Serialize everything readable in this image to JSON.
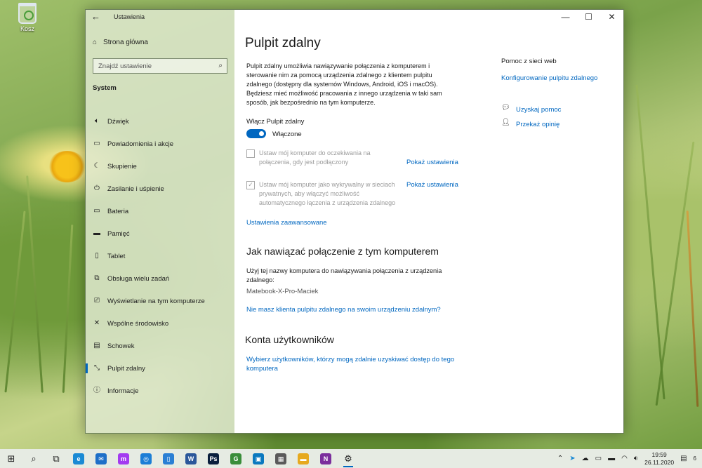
{
  "desktop": {
    "recycle_bin_label": "Kosz"
  },
  "window": {
    "title": "Ustawienia",
    "controls": {
      "minimize": "—",
      "maximize": "☐",
      "close": "✕"
    }
  },
  "sidebar": {
    "home_label": "Strona główna",
    "search_placeholder": "Znajdź ustawienie",
    "section": "System",
    "items": [
      {
        "label": "Dźwięk",
        "icon": "speaker-icon",
        "glyph": "🔈︎"
      },
      {
        "label": "Powiadomienia i akcje",
        "icon": "notifications-icon",
        "glyph": "▭"
      },
      {
        "label": "Skupienie",
        "icon": "moon-icon",
        "glyph": "☾"
      },
      {
        "label": "Zasilanie i uśpienie",
        "icon": "power-icon",
        "glyph": "⏻"
      },
      {
        "label": "Bateria",
        "icon": "battery-icon",
        "glyph": "▭"
      },
      {
        "label": "Pamięć",
        "icon": "storage-icon",
        "glyph": "▬"
      },
      {
        "label": "Tablet",
        "icon": "tablet-icon",
        "glyph": "▯"
      },
      {
        "label": "Obsługa wielu zadań",
        "icon": "multitasking-icon",
        "glyph": "⧉"
      },
      {
        "label": "Wyświetlanie na tym komputerze",
        "icon": "projecting-icon",
        "glyph": "⎚"
      },
      {
        "label": "Wspólne środowisko",
        "icon": "shared-experiences-icon",
        "glyph": "✕"
      },
      {
        "label": "Schowek",
        "icon": "clipboard-icon",
        "glyph": "▤"
      },
      {
        "label": "Pulpit zdalny",
        "icon": "remote-desktop-icon",
        "glyph": "⤡",
        "active": true
      },
      {
        "label": "Informacje",
        "icon": "info-icon",
        "glyph": "ⓘ"
      }
    ]
  },
  "main": {
    "title": "Pulpit zdalny",
    "description": "Pulpit zdalny umożliwia nawiązywanie połączenia z komputerem i sterowanie nim za pomocą urządzenia zdalnego z klientem pulpitu zdalnego (dostępny dla systemów Windows, Android, iOS i macOS). Będziesz mieć możliwość pracowania z innego urządzenia w taki sam sposób, jak bezpośrednio na tym komputerze.",
    "toggle_label": "Włącz Pulpit zdalny",
    "toggle_state": "Włączone",
    "toggle_on": true,
    "option1": {
      "label": "Ustaw mój komputer do oczekiwania na połączenia, gdy jest podłączony",
      "checked": false,
      "link": "Pokaż ustawienia"
    },
    "option2": {
      "label": "Ustaw mój komputer jako wykrywalny w sieciach prywatnych, aby włączyć możliwość automatycznego łączenia z urządzenia zdalnego",
      "checked": true,
      "link": "Pokaż ustawienia"
    },
    "advanced_link": "Ustawienia zaawansowane",
    "connect_heading": "Jak nawiązać połączenie z tym komputerem",
    "connect_text": "Użyj tej nazwy komputera do nawiązywania połączenia z urządzenia zdalnego:",
    "computer_name": "Matebook-X-Pro-Maciek",
    "no_client_link": "Nie masz klienta pulpitu zdalnego na swoim urządzeniu zdalnym?",
    "accounts_heading": "Konta użytkowników",
    "accounts_link": "Wybierz użytkowników, którzy mogą zdalnie uzyskiwać dostęp do tego komputera"
  },
  "help": {
    "heading": "Pomoc z sieci web",
    "web_link": "Konfigurowanie pulpitu zdalnego",
    "get_help": "Uzyskaj pomoc",
    "feedback": "Przekaż opinię"
  },
  "taskbar": {
    "apps": [
      {
        "name": "start-button",
        "glyph": "⊞",
        "color": ""
      },
      {
        "name": "search-button",
        "glyph": "⌕",
        "color": ""
      },
      {
        "name": "task-view-button",
        "glyph": "⧉",
        "color": ""
      },
      {
        "name": "edge-app",
        "glyph": "e",
        "color": "#1a8ad4"
      },
      {
        "name": "mail-app",
        "glyph": "✉",
        "color": "#1e6fc8"
      },
      {
        "name": "messenger-app",
        "glyph": "m",
        "color": "#a33bf0"
      },
      {
        "name": "maps-app",
        "glyph": "◎",
        "color": "#1c7ed6"
      },
      {
        "name": "phone-app",
        "glyph": "▯",
        "color": "#2a7fd4"
      },
      {
        "name": "word-app",
        "glyph": "W",
        "color": "#2b579a"
      },
      {
        "name": "photoshop-app",
        "glyph": "Ps",
        "color": "#0a1f3d"
      },
      {
        "name": "chrome-app",
        "glyph": "G",
        "color": "#3a8d3a"
      },
      {
        "name": "trello-app",
        "glyph": "▣",
        "color": "#0a79bf"
      },
      {
        "name": "calculator-app",
        "glyph": "▦",
        "color": "#5a5a5a"
      },
      {
        "name": "explorer-app",
        "glyph": "▬",
        "color": "#e6a91f"
      },
      {
        "name": "onenote-app",
        "glyph": "N",
        "color": "#7b2e9c"
      },
      {
        "name": "settings-app",
        "glyph": "⚙",
        "color": ""
      }
    ],
    "time": "19:59",
    "date": "26.11.2020",
    "notification_count": "6"
  }
}
